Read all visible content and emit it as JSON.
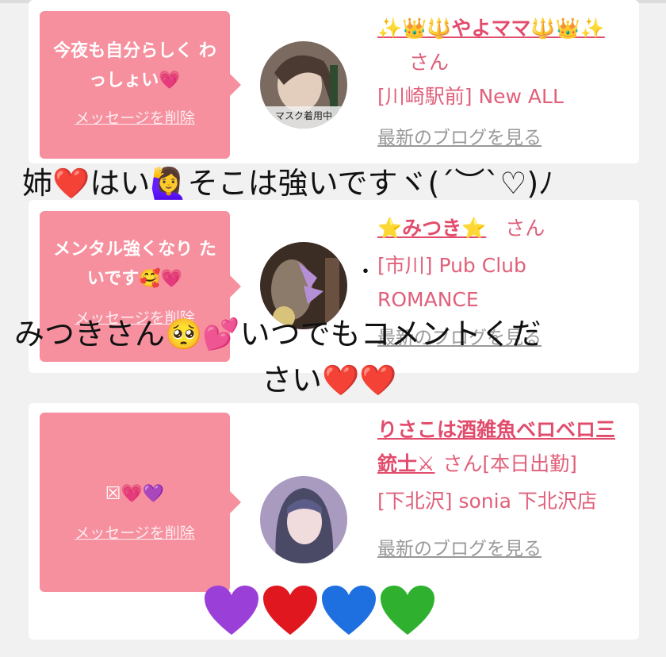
{
  "cards": [
    {
      "message": "今夜も自分らしく わっしょい💗",
      "delete_label": "メッセージを削除",
      "name": "✨👑🔱やよママ🔱👑✨",
      "san": "さん",
      "shop": "[川崎駅前] New ALL",
      "blog_link": "最新のブログを見る",
      "avatar_caption": "マスク着用中"
    },
    {
      "message": "メンタル強くなり たいです🥰💗",
      "delete_label": "メッセージを削除",
      "name": "⭐みつき⭐",
      "san": "さん",
      "shop": "[市川] Pub Club ROMANCE",
      "blog_link": "最新のブログを見る"
    },
    {
      "message": "☒💗💜",
      "delete_label": "メッセージを削除",
      "name": "りさこは酒雑魚ベロベロ三銃士⚔",
      "san": "さん[本日出勤]",
      "shop": "[下北沢] sonia 下北沢店",
      "blog_link": "最新のブログを見る"
    }
  ],
  "overlay": {
    "line1": "姉❤️はい🙋‍♀️そこは強いですヾ(´︶`♡)ﾉ",
    "line2": "みつきさん🥺💕いつでもコメントくだ",
    "line3": "さい❤️❤️",
    "dot": "・"
  },
  "colors": {
    "bubble": "#f6909f",
    "name": "#e24c6c",
    "text": "#e0607a",
    "background": "#f1f1f2"
  },
  "big_hearts": [
    "purple",
    "red",
    "blue",
    "green"
  ]
}
